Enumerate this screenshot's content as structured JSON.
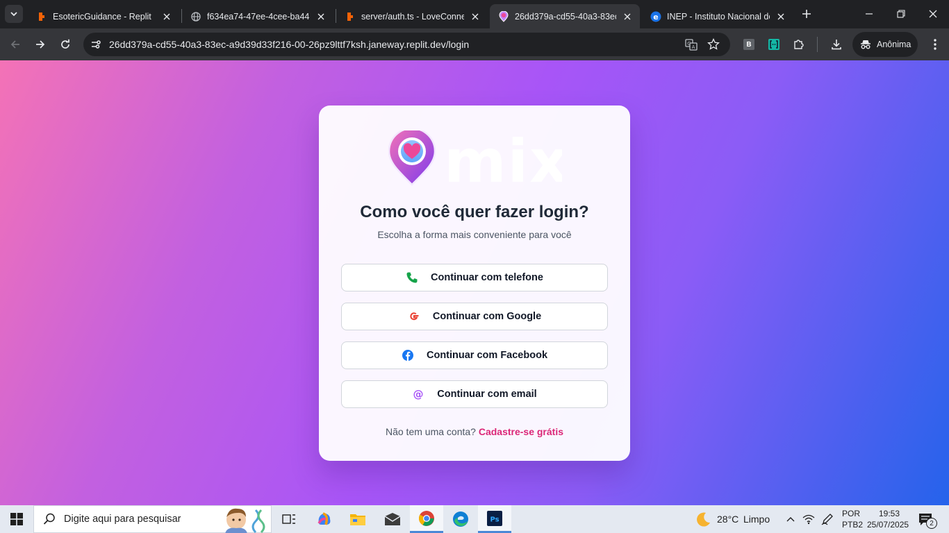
{
  "browser": {
    "tabs": [
      {
        "title": "EsotericGuidance - Replit",
        "favicon": "replit-icon",
        "active": false
      },
      {
        "title": "f634ea74-47ee-4cee-ba44-d",
        "favicon": "globe-icon",
        "active": false
      },
      {
        "title": "server/auth.ts - LoveConnect",
        "favicon": "replit-icon",
        "active": false
      },
      {
        "title": "26dd379a-cd55-40a3-83ec-a",
        "favicon": "mix-heart-icon",
        "active": true
      },
      {
        "title": "INEP - Instituto Nacional de",
        "favicon": "edge-e-icon",
        "active": false
      }
    ],
    "url": "26dd379a-cd55-40a3-83ec-a9d39d33f216-00-26pz9lttf7ksh.janeway.replit.dev/login",
    "profile_label": "Anônima",
    "extension_b_label": "B"
  },
  "page": {
    "logo_text": "mix",
    "heading": "Como você quer fazer login?",
    "subheading": "Escolha a forma mais conveniente para você",
    "buttons": [
      {
        "label": "Continuar com telefone",
        "icon": "phone-icon"
      },
      {
        "label": "Continuar com Google",
        "icon": "google-icon"
      },
      {
        "label": "Continuar com Facebook",
        "icon": "facebook-icon"
      },
      {
        "label": "Continuar com email",
        "icon": "at-icon"
      }
    ],
    "signup_prompt": "Não tem uma conta?",
    "signup_link": "Cadastre-se grátis",
    "colors": {
      "accent_pink": "#db2777",
      "heading_text": "#1f2937",
      "phone_green": "#16a34a",
      "facebook_blue": "#1877f2",
      "at_purple": "#a855f7"
    }
  },
  "taskbar": {
    "search_placeholder": "Digite aqui para pesquisar",
    "weather_temp": "28°C",
    "weather_desc": "Limpo",
    "lang_top": "POR",
    "lang_bottom": "PTB2",
    "time": "19:53",
    "date": "25/07/2025",
    "notification_count": "2"
  }
}
